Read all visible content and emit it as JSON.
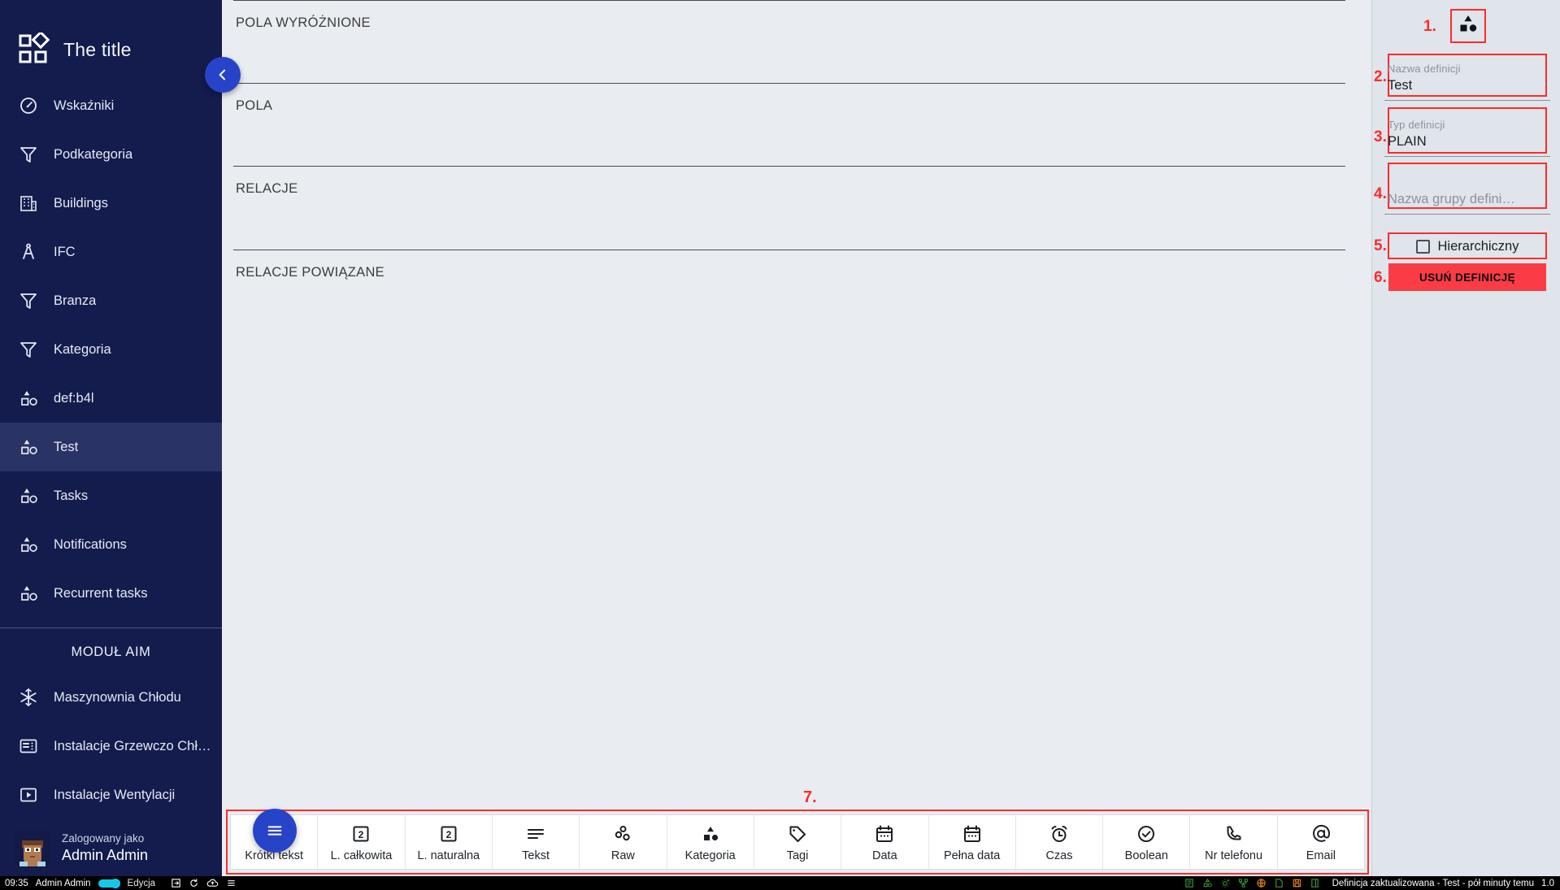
{
  "sidebar": {
    "brand_title": "The title",
    "collapse_icon": "chevron-left-icon",
    "items": [
      {
        "label": "Wskaźniki",
        "icon": "gauge-icon",
        "active": false
      },
      {
        "label": "Podkategoria",
        "icon": "filter-icon",
        "active": false
      },
      {
        "label": "Buildings",
        "icon": "building-icon",
        "active": false
      },
      {
        "label": "IFC",
        "icon": "compass-icon",
        "active": false
      },
      {
        "label": "Branza",
        "icon": "filter-icon",
        "active": false
      },
      {
        "label": "Kategoria",
        "icon": "filter-icon",
        "active": false
      },
      {
        "label": "def:b4l",
        "icon": "shapes-icon",
        "active": false
      },
      {
        "label": "Test",
        "icon": "shapes-icon",
        "active": true
      },
      {
        "label": "Tasks",
        "icon": "shapes-icon",
        "active": false
      },
      {
        "label": "Notifications",
        "icon": "shapes-icon",
        "active": false
      },
      {
        "label": "Recurrent tasks",
        "icon": "shapes-icon",
        "active": false
      }
    ],
    "section_title": "MODUŁ AIM",
    "module_items": [
      {
        "label": "Maszynownia Chłodu",
        "icon": "snowflake-icon"
      },
      {
        "label": "Instalacje Grzewczo Chłod…",
        "icon": "panel-icon"
      },
      {
        "label": "Instalacje Wentylacji",
        "icon": "play-box-icon"
      }
    ],
    "user": {
      "caption": "Zalogowany jako",
      "name": "Admin Admin",
      "avatar_icon": "avatar"
    }
  },
  "main": {
    "sections": [
      {
        "title": "POLA WYRÓŻNIONE"
      },
      {
        "title": "POLA"
      },
      {
        "title": "RELACJE"
      },
      {
        "title": "RELACJE POWIĄZANE"
      }
    ],
    "toolbar_marker": "7.",
    "fab_icon": "menu-icon",
    "toolbar": [
      {
        "label": "Krótki tekst",
        "icon": "menu-icon"
      },
      {
        "label": "L. całkowita",
        "icon": "number-box-icon"
      },
      {
        "label": "L. naturalna",
        "icon": "number-box-icon"
      },
      {
        "label": "Tekst",
        "icon": "text-lines-icon"
      },
      {
        "label": "Raw",
        "icon": "circles-icon"
      },
      {
        "label": "Kategoria",
        "icon": "shapes-icon"
      },
      {
        "label": "Tagi",
        "icon": "tag-icon"
      },
      {
        "label": "Data",
        "icon": "calendar-icon"
      },
      {
        "label": "Pełna data",
        "icon": "calendar-icon"
      },
      {
        "label": "Czas",
        "icon": "alarm-clock-icon"
      },
      {
        "label": "Boolean",
        "icon": "check-circle-icon"
      },
      {
        "label": "Nr telefonu",
        "icon": "phone-icon"
      },
      {
        "label": "Email",
        "icon": "at-icon"
      }
    ]
  },
  "right_panel": {
    "markers": [
      "1.",
      "2.",
      "3.",
      "4.",
      "5.",
      "6."
    ],
    "definition_icon": "shapes-icon",
    "name_field": {
      "label": "Nazwa definicji",
      "value": "Test"
    },
    "type_field": {
      "label": "Typ definicji",
      "value": "PLAIN"
    },
    "group_field": {
      "label": "",
      "placeholder": "Nazwa grupy defini…",
      "value": ""
    },
    "hierarchical": {
      "label": "Hierarchiczny",
      "checked": false
    },
    "delete_button": "USUŃ DEFINICJĘ"
  },
  "statusbar": {
    "clock": "09:35",
    "user": "Admin Admin",
    "mode": "Edycja",
    "left_icons": [
      "login-icon",
      "refresh-icon",
      "cloud-upload-icon",
      "menu-icon"
    ],
    "right_icons": [
      "database-icon",
      "shapes-icon",
      "gear-plus-icon",
      "sitemap-icon",
      "globe-icon",
      "file-icon",
      "save-icon",
      "exit-icon"
    ],
    "message": "Definicja zaktualizowana - Test - pół minuty temu",
    "version": "1.0"
  },
  "colors": {
    "sidebar_bg": "#131c4d",
    "accent_blue": "#2744c8",
    "annotation_red": "#ff2b2b",
    "delete_red": "#fa3c46",
    "content_bg": "#e9edf1",
    "panel_bg": "#dfe5eb"
  }
}
